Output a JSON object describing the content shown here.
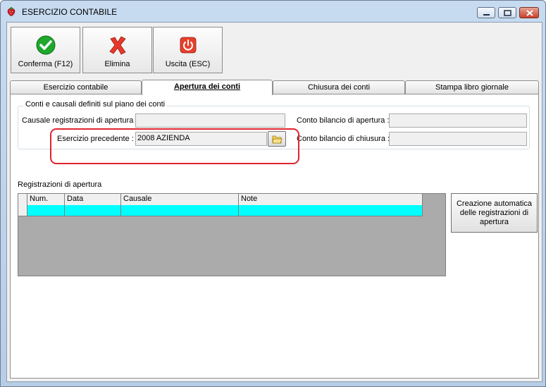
{
  "window": {
    "title": "ESERCIZIO CONTABILE"
  },
  "toolbar": {
    "confirm_label": "Conferma (F12)",
    "delete_label": "Elimina",
    "exit_label": "Uscita (ESC)"
  },
  "tabs": [
    {
      "label": "Esercizio contabile"
    },
    {
      "label": "Apertura dei conti"
    },
    {
      "label": "Chiusura dei conti"
    },
    {
      "label": "Stampa libro giornale"
    }
  ],
  "group": {
    "legend": "Conti e causali definiti sul piano dei conti",
    "causale_label": "Causale registrazioni di apertura :",
    "causale_value": "",
    "conto_apertura_label": "Conto bilancio di apertura :",
    "conto_apertura_value": "",
    "esercizio_label": "Esercizio precedente :",
    "esercizio_value": "2008 AZIENDA",
    "conto_chiusura_label": "Conto bilancio di chiusura :",
    "conto_chiusura_value": ""
  },
  "registrations": {
    "title": "Registrazioni di apertura",
    "columns": [
      "Num.",
      "Data",
      "Causale",
      "Note"
    ]
  },
  "auto_button": {
    "line1": "Creazione automatica",
    "line2": "delle registrazioni di",
    "line3": "apertura"
  },
  "colors": {
    "selected_row": "#00ffff",
    "highlight": "#e0242d"
  }
}
